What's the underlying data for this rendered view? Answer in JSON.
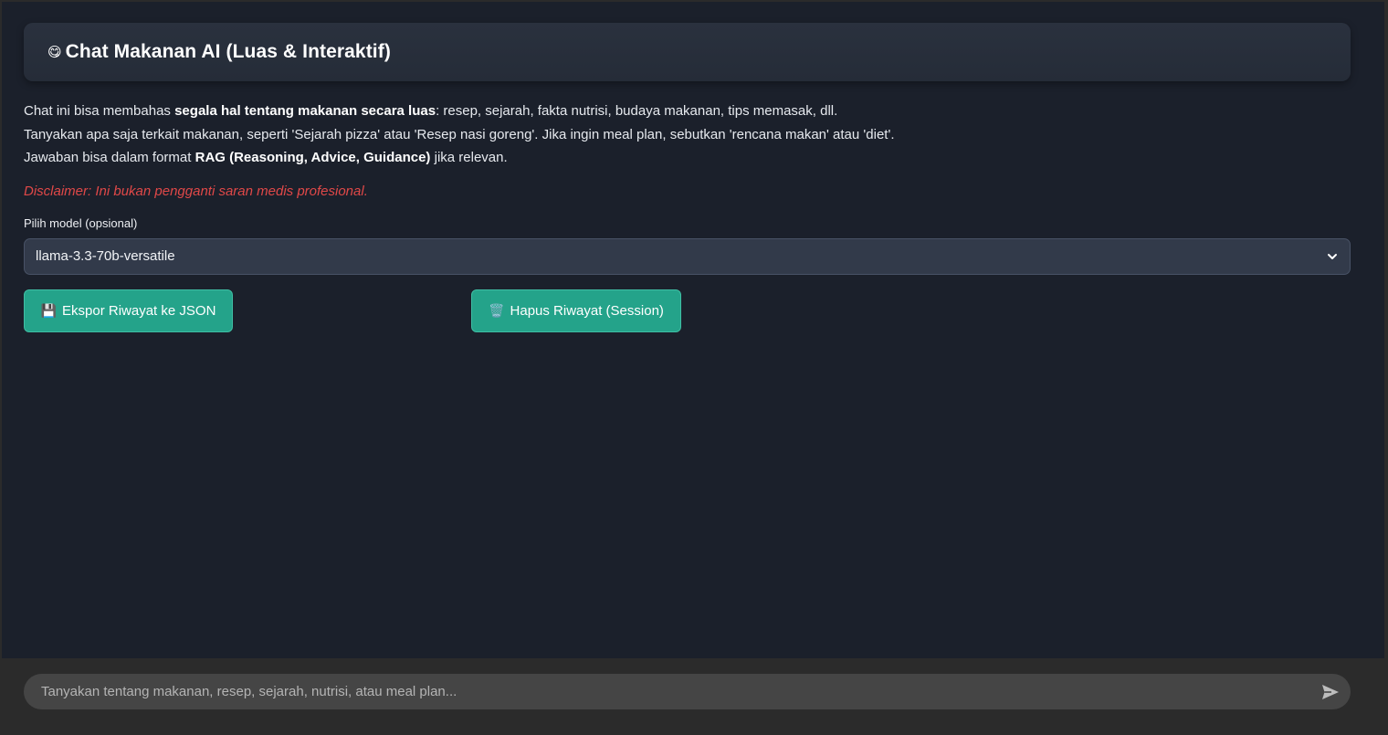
{
  "header": {
    "emoji": "😋",
    "title": "Chat Makanan AI (Luas & Interaktif)"
  },
  "description": {
    "line1_prefix": "Chat ini bisa membahas ",
    "line1_bold": "segala hal tentang makanan secara luas",
    "line1_suffix": ": resep, sejarah, fakta nutrisi, budaya makanan, tips memasak, dll.",
    "line2": "Tanyakan apa saja terkait makanan, seperti 'Sejarah pizza' atau 'Resep nasi goreng'. Jika ingin meal plan, sebutkan 'rencana makan' atau 'diet'.",
    "line3_prefix": "Jawaban bisa dalam format ",
    "line3_bold": "RAG (Reasoning, Advice, Guidance)",
    "line3_suffix": " jika relevan."
  },
  "disclaimer": "Disclaimer: Ini bukan pengganti saran medis profesional.",
  "model_select": {
    "label": "Pilih model (opsional)",
    "value": "llama-3.3-70b-versatile",
    "icon": "chevron-down-icon"
  },
  "buttons": {
    "export": {
      "icon": "💾",
      "label": "Ekspor Riwayat ke JSON"
    },
    "clear": {
      "icon": "🗑️",
      "label": "Hapus Riwayat (Session)"
    }
  },
  "chat_input": {
    "placeholder": "Tanyakan tentang makanan, resep, sejarah, nutrisi, atau meal plan...",
    "value": "",
    "send_icon": "send-icon"
  },
  "colors": {
    "background": "#1b202b",
    "accent_button": "#24a38a",
    "disclaimer": "#e04848",
    "footer": "#2b2b2b",
    "input_bg": "#454545"
  }
}
